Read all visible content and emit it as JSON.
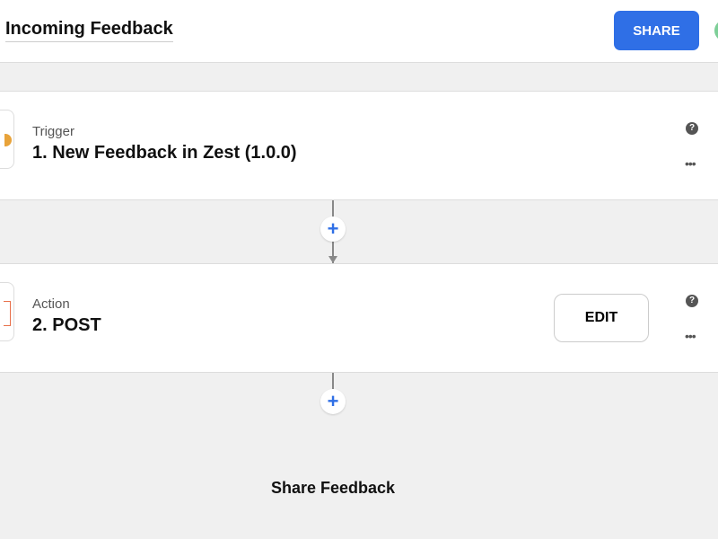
{
  "header": {
    "title": "Incoming Feedback",
    "share_label": "SHARE"
  },
  "steps": [
    {
      "kind": "Trigger",
      "title": "1. New Feedback in Zest (1.0.0)",
      "help": "?",
      "more": "•••"
    },
    {
      "kind": "Action",
      "title": "2. POST",
      "edit_label": "EDIT",
      "help": "?",
      "more": "•••"
    }
  ],
  "add_step": "+",
  "footer": {
    "label": "Share Feedback"
  },
  "colors": {
    "accent": "#2f6fe6"
  }
}
